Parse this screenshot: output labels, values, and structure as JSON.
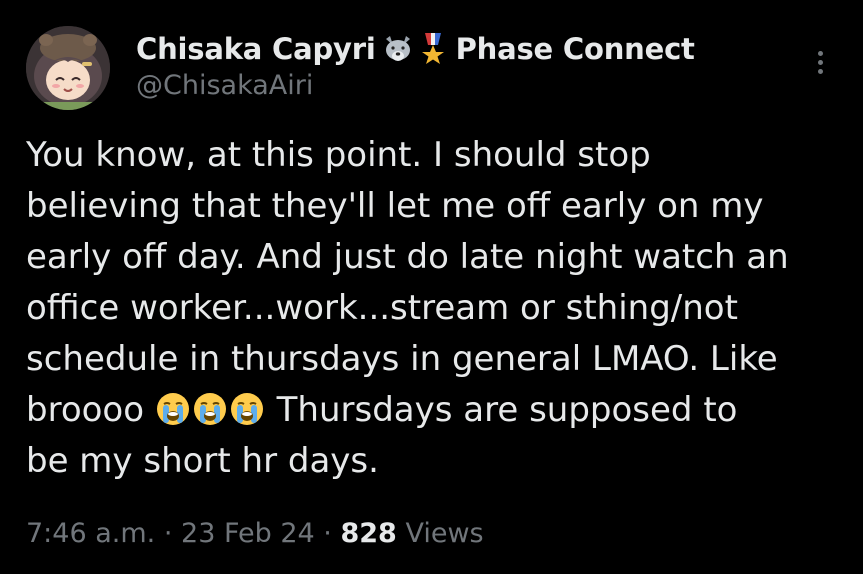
{
  "author": {
    "display_name": "Chisaka Capyri",
    "name_emojis": [
      "wolf-icon",
      "military-medal-icon"
    ],
    "affiliation": "Phase Connect",
    "handle": "@ChisakaAiri"
  },
  "tweet": {
    "lines": [
      "You know, at this point. I should stop",
      "believing that they'll let me off early on my",
      "early off day. And just do late night watch an",
      "office worker...work...stream or sthing/not",
      "schedule in thursdays in general LMAO. Like"
    ],
    "line6_prefix": "broooo",
    "line6_emojis": [
      "loudly-crying-face-icon",
      "loudly-crying-face-icon",
      "loudly-crying-face-icon"
    ],
    "line6_suffix": "Thursdays are supposed to",
    "line7": "be my short hr days."
  },
  "meta": {
    "time": "7:46 a.m.",
    "separator": "·",
    "date": "23 Feb 24",
    "views_count": "828",
    "views_label": "Views"
  },
  "colors": {
    "background": "#000000",
    "primary_text": "#e7e9ea",
    "secondary_text": "#71767b"
  }
}
